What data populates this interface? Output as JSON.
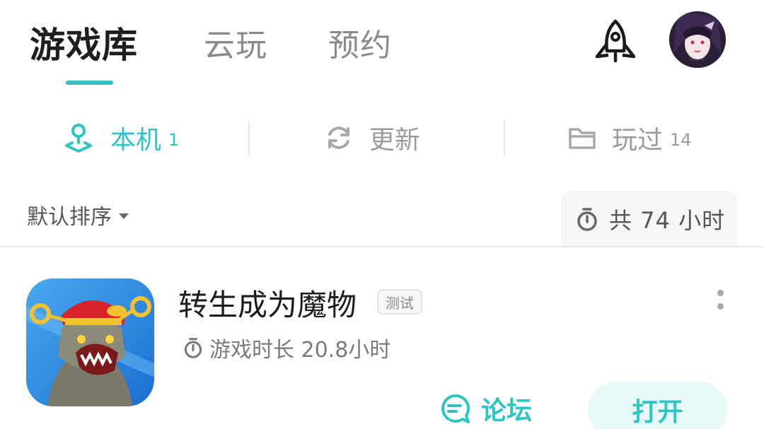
{
  "header": {
    "tabs": [
      {
        "label": "游戏库",
        "active": true
      },
      {
        "label": "云玩",
        "active": false
      },
      {
        "label": "预约",
        "active": false
      }
    ],
    "accent_color": "#2ec4c4",
    "icons": [
      "rocket-icon",
      "avatar"
    ]
  },
  "sub_tabs": [
    {
      "label": "本机",
      "count": "1",
      "icon": "local-device-icon",
      "active": true
    },
    {
      "label": "更新",
      "count": "",
      "icon": "refresh-icon",
      "active": false
    },
    {
      "label": "玩过",
      "count": "14",
      "icon": "folder-icon",
      "active": false
    }
  ],
  "sort": {
    "label": "默认排序"
  },
  "total_playtime": {
    "label": "共 74 小时",
    "icon": "stopwatch-icon"
  },
  "games": [
    {
      "title": "转生成为魔物",
      "badge": "测试",
      "duration": "游戏时长 20.8小时",
      "forum_label": "论坛",
      "open_label": "打开"
    }
  ]
}
